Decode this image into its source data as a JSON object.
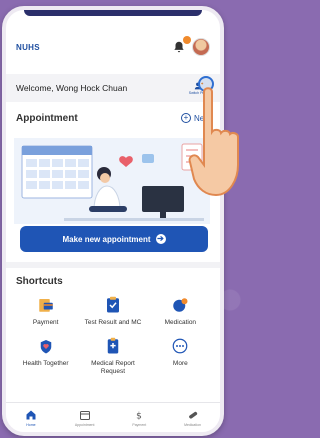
{
  "header": {
    "logo_text": "NUHS",
    "welcome": "Welcome, Wong Hock Chuan",
    "switch_label": "Switch Profile"
  },
  "appointment": {
    "title": "Appointment",
    "new_label": "New",
    "make_button": "Make new appointment"
  },
  "shortcuts": {
    "title": "Shortcuts",
    "items": [
      {
        "label": "Payment",
        "icon": "payment-icon"
      },
      {
        "label": "Test Result and MC",
        "icon": "test-result-icon"
      },
      {
        "label": "Medication",
        "icon": "medication-icon"
      },
      {
        "label": "Health Together",
        "icon": "health-together-icon"
      },
      {
        "label": "Medical Report Request",
        "icon": "medical-report-icon"
      },
      {
        "label": "More",
        "icon": "more-icon"
      }
    ]
  },
  "nav": {
    "items": [
      {
        "label": "Home",
        "icon": "home-icon"
      },
      {
        "label": "Appointment",
        "icon": "calendar-icon"
      },
      {
        "label": "Payment",
        "icon": "dollar-icon"
      },
      {
        "label": "Medication",
        "icon": "pill-icon"
      }
    ]
  },
  "colors": {
    "primary": "#1f55b5",
    "accent": "#f08a2c",
    "background": "#8a6bb0"
  }
}
